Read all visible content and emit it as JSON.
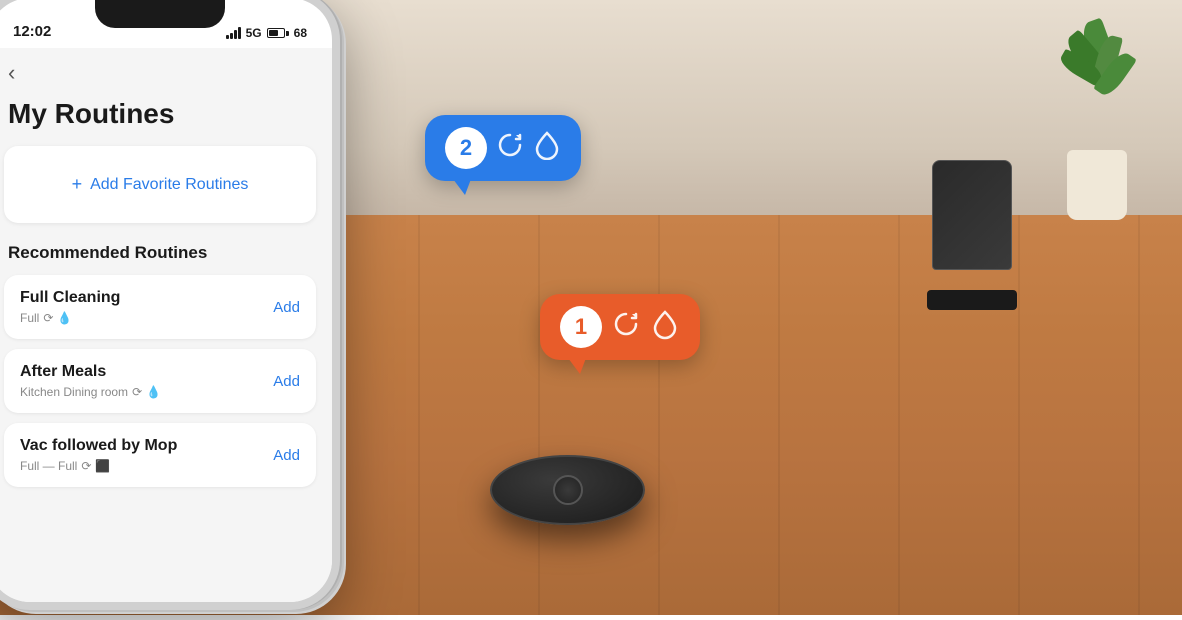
{
  "background": {
    "description": "Room with wood floor and robot vacuums"
  },
  "phone": {
    "status_bar": {
      "time": "12:02",
      "signal": "5G",
      "battery_label": "68"
    },
    "header": {
      "title": "My Routines",
      "back_label": "‹"
    },
    "favorite_card": {
      "add_label": "Add Favorite Routines",
      "add_icon": "+"
    },
    "recommended_section": {
      "title": "Recommended Routines",
      "routines": [
        {
          "name": "Full Cleaning",
          "meta": "Full",
          "add_label": "Add"
        },
        {
          "name": "After Meals",
          "meta": "Kitchen Dining room",
          "add_label": "Add"
        },
        {
          "name": "Vac followed by Mop",
          "meta": "Full — Full",
          "add_label": "Add"
        }
      ]
    }
  },
  "bubbles": {
    "orange": {
      "number": "1",
      "icon1": "↻",
      "icon2": "💧"
    },
    "blue": {
      "number": "2",
      "icon1": "↻",
      "icon2": "💧"
    }
  }
}
